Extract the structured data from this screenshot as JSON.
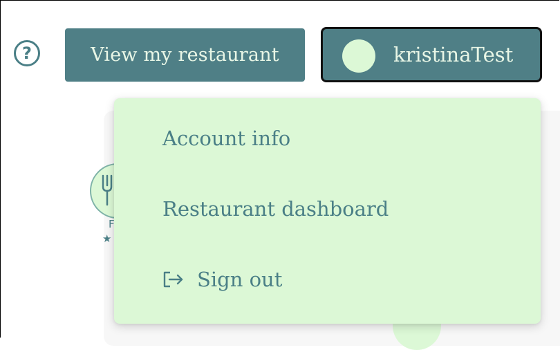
{
  "header": {
    "help_icon_glyph": "?",
    "view_restaurant_label": "View my restaurant",
    "user_name": "kristinaTest"
  },
  "background": {
    "logo_letter": "F",
    "rating_star": "★"
  },
  "dropdown": {
    "items": [
      {
        "label": "Account info"
      },
      {
        "label": "Restaurant dashboard"
      },
      {
        "label": "Sign out",
        "icon": "sign-out-icon"
      }
    ]
  },
  "colors": {
    "accent": "#4f7f86",
    "menu_bg": "#dcf8d6",
    "text_on_accent": "#e8f6e6",
    "menu_text": "#4a7f86"
  }
}
